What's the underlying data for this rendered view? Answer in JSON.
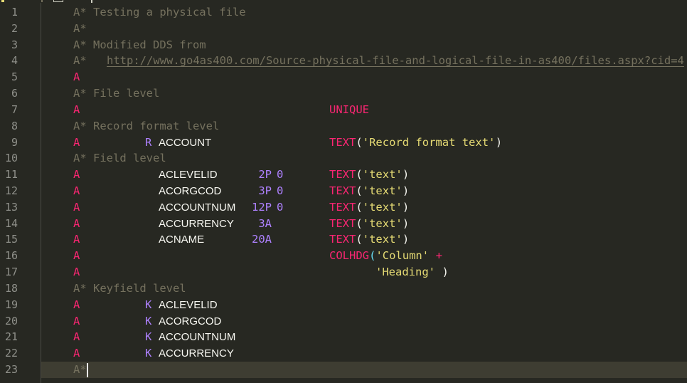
{
  "editor": {
    "current_line": 23,
    "lines": [
      {
        "n": "1",
        "comment": "A* Testing a physical file"
      },
      {
        "n": "2",
        "comment": "A*"
      },
      {
        "n": "3",
        "comment": "A* Modified DDS from"
      },
      {
        "n": "4",
        "comment": "A*",
        "url": "http://www.go4as400.com/Source-physical-file-and-logical-file-in-as400/files.aspx?cid=4"
      },
      {
        "n": "5",
        "a": "A"
      },
      {
        "n": "6",
        "comment": "A* File level"
      },
      {
        "n": "7",
        "a": "A",
        "keyword": "UNIQUE"
      },
      {
        "n": "8",
        "comment": "A* Record format level"
      },
      {
        "n": "9",
        "a": "A",
        "type": "R",
        "name": "ACCOUNT",
        "keyword": "TEXT",
        "open": "(",
        "string": "'Record format text'",
        "close": ")"
      },
      {
        "n": "10",
        "comment": "A* Field level"
      },
      {
        "n": "11",
        "a": "A",
        "name": "ACLEVELID",
        "len": "2P",
        "dec": "0",
        "keyword": "TEXT",
        "open": "(",
        "string": "'text'",
        "close": ")"
      },
      {
        "n": "12",
        "a": "A",
        "name": "ACORGCOD",
        "len": "3P",
        "dec": "0",
        "keyword": "TEXT",
        "open": "(",
        "string": "'text'",
        "close": ")"
      },
      {
        "n": "13",
        "a": "A",
        "name": "ACCOUNTNUM",
        "len": "12P",
        "dec": "0",
        "keyword": "TEXT",
        "open": "(",
        "string": "'text'",
        "close": ")"
      },
      {
        "n": "14",
        "a": "A",
        "name": "ACCURRENCY",
        "len": "3A",
        "keyword": "TEXT",
        "open": "(",
        "string": "'text'",
        "close": ")"
      },
      {
        "n": "15",
        "a": "A",
        "name": "ACNAME",
        "len": "20A",
        "keyword": "TEXT",
        "open": "(",
        "string": "'text'",
        "close": ")"
      },
      {
        "n": "16",
        "a": "A",
        "keyword": "COLHDG",
        "open": "(",
        "string": "'Column'",
        "plus": "+"
      },
      {
        "n": "17",
        "a": "A",
        "string2": "'Heading'",
        "close2": ")"
      },
      {
        "n": "18",
        "comment": "A* Keyfield level"
      },
      {
        "n": "19",
        "a": "A",
        "type": "K",
        "name": "ACLEVELID"
      },
      {
        "n": "20",
        "a": "A",
        "type": "K",
        "name": "ACORGCOD"
      },
      {
        "n": "21",
        "a": "A",
        "type": "K",
        "name": "ACCOUNTNUM"
      },
      {
        "n": "22",
        "a": "A",
        "type": "K",
        "name": "ACCURRENCY"
      },
      {
        "n": "23",
        "comment": "A*"
      }
    ]
  }
}
